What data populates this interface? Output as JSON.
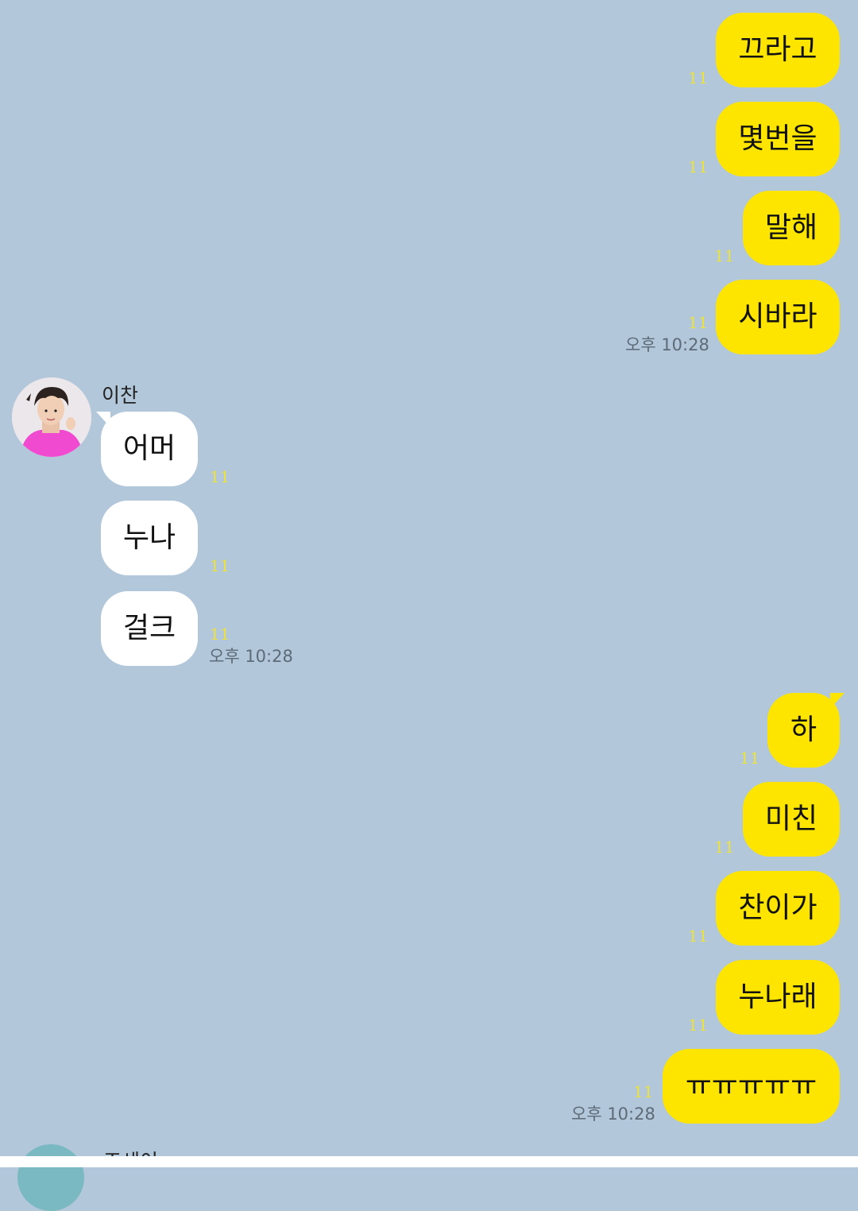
{
  "theme": {
    "background": "#b2c7da",
    "my_bubble": "#fee500",
    "their_bubble": "#ffffff",
    "unread_color": "#ece23e"
  },
  "messages": [
    {
      "sender": "me",
      "text": "끄라고",
      "unread": "11",
      "time": ""
    },
    {
      "sender": "me",
      "text": "몇번을",
      "unread": "11",
      "time": ""
    },
    {
      "sender": "me",
      "text": "말해",
      "unread": "11",
      "time": ""
    },
    {
      "sender": "me",
      "text": "시바라",
      "unread": "11",
      "time": "오후 10:28"
    },
    {
      "sender": "other",
      "name": "이찬",
      "text": "어머",
      "unread": "11",
      "time": ""
    },
    {
      "sender": "other",
      "text": "누나",
      "unread": "11",
      "time": ""
    },
    {
      "sender": "other",
      "text": "걸크",
      "unread": "11",
      "time": "오후 10:28"
    },
    {
      "sender": "me",
      "text": "하",
      "unread": "11",
      "time": ""
    },
    {
      "sender": "me",
      "text": "미친",
      "unread": "11",
      "time": ""
    },
    {
      "sender": "me",
      "text": "찬이가",
      "unread": "11",
      "time": ""
    },
    {
      "sender": "me",
      "text": "누나래",
      "unread": "11",
      "time": ""
    },
    {
      "sender": "me",
      "text": "ㅠㅠㅠㅠㅠ",
      "unread": "11",
      "time": "오후 10:28"
    }
  ],
  "partial_next_sender": {
    "name": "조세이"
  }
}
